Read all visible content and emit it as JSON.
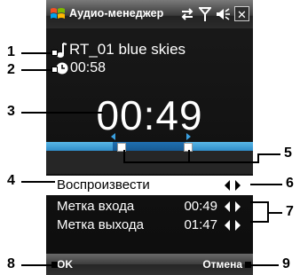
{
  "titlebar": {
    "title": "Аудио-менеджер",
    "icons": [
      "windows-start-icon",
      "sync-icon",
      "signal-icon",
      "volume-icon",
      "close-icon"
    ],
    "close_glyph": "✕"
  },
  "track": {
    "name": "RT_01 blue skies",
    "icon": "music-note-icon"
  },
  "duration": {
    "value": "00:58",
    "icon": "clock-icon"
  },
  "current_time": "00:49",
  "progress": {
    "played_fraction": 0.5
  },
  "menu": {
    "items": [
      {
        "label": "Воспроизвести",
        "value": ""
      },
      {
        "label": "Метка входа",
        "value": "00:49"
      },
      {
        "label": "Метка выхода",
        "value": "01:47"
      }
    ]
  },
  "softkeys": {
    "left": "OK",
    "right": "Отмена"
  },
  "callouts": [
    "1",
    "2",
    "3",
    "4",
    "5",
    "6",
    "7",
    "8",
    "9"
  ],
  "colors": {
    "accent": "#2f8dc9",
    "progress_played": "#175a93",
    "selection": "#ffffff",
    "background": "#111111"
  }
}
